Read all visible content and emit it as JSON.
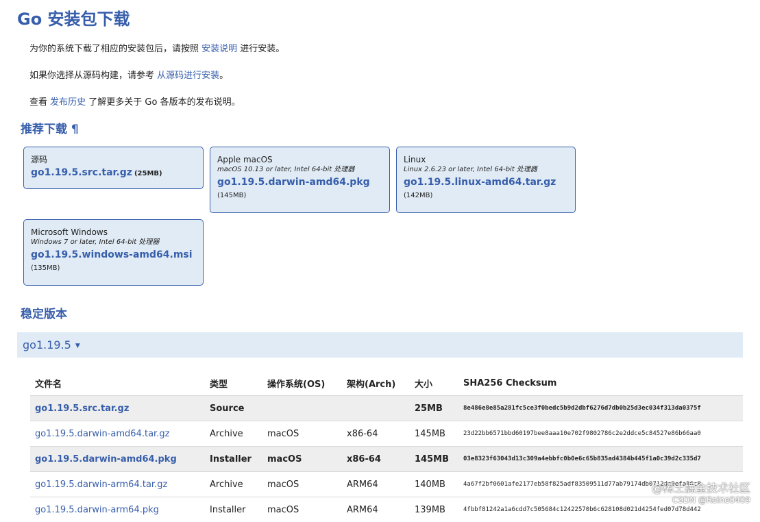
{
  "page_title": "Go 安装包下载",
  "intro": {
    "p1_before": "为你的系统下载了相应的安装包后，请按照 ",
    "p1_link": "安装说明",
    "p1_after": " 进行安装。",
    "p2_before": "如果你选择从源码构建，请参考 ",
    "p2_link": "从源码进行安装",
    "p2_after": "。",
    "p3_before": "查看 ",
    "p3_link": "发布历史",
    "p3_after": " 了解更多关于 Go 各版本的发布说明。"
  },
  "featured": {
    "heading": "推荐下载 ¶",
    "cards": [
      {
        "os": "源码",
        "requirement": "",
        "filename": "go1.19.5.src.tar.gz",
        "size": "(25MB)"
      },
      {
        "os": "Apple macOS",
        "requirement": "macOS 10.13 or later, Intel 64-bit 处理器",
        "filename": "go1.19.5.darwin-amd64.pkg",
        "size": "(145MB)"
      },
      {
        "os": "Linux",
        "requirement": "Linux 2.6.23 or later, Intel 64-bit 处理器",
        "filename": "go1.19.5.linux-amd64.tar.gz",
        "size": "(142MB)"
      },
      {
        "os": "Microsoft Windows",
        "requirement": "Windows 7 or later, Intel 64-bit 处理器",
        "filename": "go1.19.5.windows-amd64.msi",
        "size": "(135MB)"
      }
    ]
  },
  "stable": {
    "heading": "稳定版本",
    "version_label": "go1.19.5",
    "caret": "▼",
    "table": {
      "headers": [
        "文件名",
        "类型",
        "操作系统(OS)",
        "架构(Arch)",
        "大小",
        "SHA256 Checksum"
      ],
      "rows": [
        {
          "filename": "go1.19.5.src.tar.gz",
          "kind": "Source",
          "os": "",
          "arch": "",
          "size": "25MB",
          "checksum": "8e486e8e85a281fc5ce3f0bedc5b9d2dbf6276d7db0b25d3ec034f313da0375f"
        },
        {
          "filename": "go1.19.5.darwin-amd64.tar.gz",
          "kind": "Archive",
          "os": "macOS",
          "arch": "x86-64",
          "size": "145MB",
          "checksum": "23d22bb6571bbd60197bee8aaa10e702f9802786c2e2ddce5c84527e86b66aa0"
        },
        {
          "filename": "go1.19.5.darwin-amd64.pkg",
          "kind": "Installer",
          "os": "macOS",
          "arch": "x86-64",
          "size": "145MB",
          "checksum": "03e8323f63043d13c309a4ebbfc0b0e6c65b835ad4384b445f1a0c39d2c335d7"
        },
        {
          "filename": "go1.19.5.darwin-arm64.tar.gz",
          "kind": "Archive",
          "os": "macOS",
          "arch": "ARM64",
          "size": "140MB",
          "checksum": "4a67f2bf0601afe2177eb58f825adf83509511d77ab79174db0712dc9efa16c8"
        },
        {
          "filename": "go1.19.5.darwin-arm64.pkg",
          "kind": "Installer",
          "os": "macOS",
          "arch": "ARM64",
          "size": "139MB",
          "checksum": "4fbbf81242a1a6cdd7c505684c12422570b6c628108d021d4254fed07d78d442"
        }
      ]
    }
  },
  "watermark": {
    "line1": "@稀土掘金技术社区",
    "line2": "CSDN @Reine0409"
  }
}
